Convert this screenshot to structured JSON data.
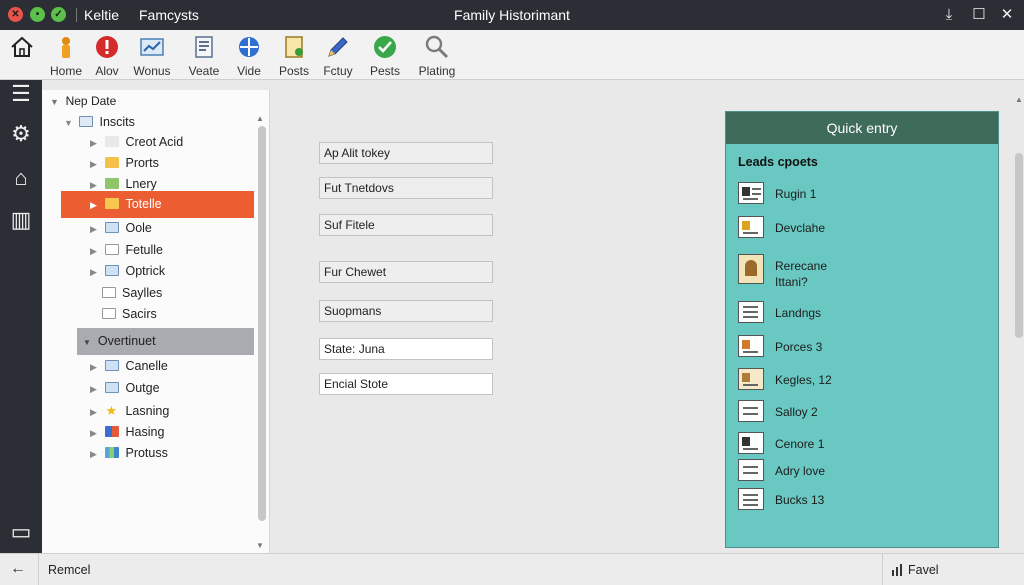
{
  "window": {
    "app_name": "Keltie",
    "file_name": "Famcysts",
    "title": "Family Historimant",
    "controls": [
      "download-icon",
      "maximize-icon",
      "close-icon"
    ]
  },
  "toolbar": {
    "items": [
      {
        "label": "Home",
        "icon": "home-icon"
      },
      {
        "label": "Alov",
        "icon": "person-icon"
      },
      {
        "label": "Wonus",
        "icon": "alert-icon"
      },
      {
        "label": "Veate",
        "icon": "chart-icon"
      },
      {
        "label": "Vide",
        "icon": "document-icon"
      },
      {
        "label": "Posts",
        "icon": "globe-icon"
      },
      {
        "label": "Fctuy",
        "icon": "note-icon"
      },
      {
        "label": "Pests",
        "icon": "pencil-icon"
      },
      {
        "label": "Plating",
        "icon": "search-icon"
      }
    ]
  },
  "rail": {
    "icons": [
      "list-icon",
      "gear-icon",
      "home-icon",
      "panel-icon",
      "chat-icon"
    ]
  },
  "tree": {
    "header": "Nep Date",
    "rows": [
      {
        "label": "Inscits",
        "icon": "folder-icon"
      },
      {
        "label": "Creot Acid",
        "icon": "folder-icon"
      },
      {
        "label": "Prorts",
        "icon": "folder-icon"
      },
      {
        "label": "Lnery",
        "icon": "folder-icon"
      },
      {
        "label": "Totelle",
        "icon": "folder-icon",
        "selected": true
      },
      {
        "label": "Oole",
        "icon": "folder-icon"
      },
      {
        "label": "Fetulle",
        "icon": "page-icon"
      },
      {
        "label": "Optrick",
        "icon": "folder-icon"
      },
      {
        "label": "Saylles",
        "icon": "page-icon"
      },
      {
        "label": "Sacirs",
        "icon": "page-icon"
      }
    ],
    "group_label": "Overtinuet",
    "group_rows": [
      {
        "label": "Canelle",
        "icon": "folder-icon"
      },
      {
        "label": "Outge",
        "icon": "folder-icon"
      },
      {
        "label": "Lasning",
        "icon": "star-icon"
      },
      {
        "label": "Hasing",
        "icon": "grid-icon"
      },
      {
        "label": "Protuss",
        "icon": "chart-icon"
      }
    ]
  },
  "form": {
    "fields": [
      "Ap Alit tokey",
      "Fut Tnetdovs",
      "Suf Fitele",
      "Fur Chewet",
      "Suopmans",
      "State: Juna",
      "Encial Stote"
    ]
  },
  "quick_entry": {
    "title": "Quick entry",
    "subtitle": "Leads cpoets",
    "items": [
      {
        "line1": "Rugin 1",
        "line2": ""
      },
      {
        "line1": "Devclahe",
        "line2": ""
      },
      {
        "line1": "Rerecane",
        "line2": "Ittani?"
      },
      {
        "line1": "Landngs",
        "line2": ""
      },
      {
        "line1": "Porces 3",
        "line2": ""
      },
      {
        "line1": "Kegles, 12",
        "line2": ""
      },
      {
        "line1": "Salloy 2",
        "line2": ""
      },
      {
        "line1": "Cenore 1",
        "line2": ""
      },
      {
        "line1": "Adry love",
        "line2": ""
      },
      {
        "line1": "Bucks 13",
        "line2": ""
      }
    ]
  },
  "statusbar": {
    "left": "Remcel",
    "right": "Favel"
  },
  "colors": {
    "titlebar": "#2b2e35",
    "selection": "#ec5d32",
    "quick_entry_bg": "#6ac8c2",
    "quick_entry_header": "#3f6b5b"
  }
}
